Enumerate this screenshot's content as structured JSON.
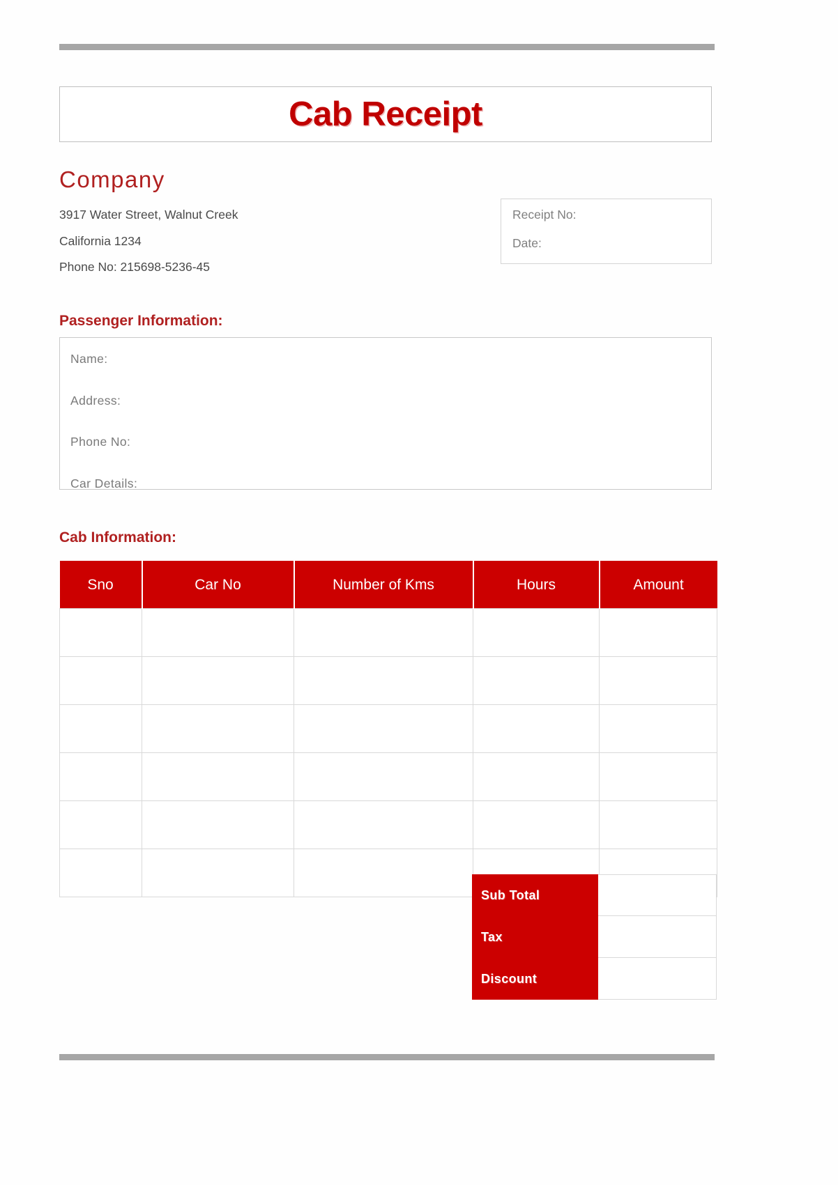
{
  "document": {
    "title": "Cab Receipt"
  },
  "company": {
    "name": "Company",
    "address_line1": "3917 Water Street, Walnut Creek",
    "address_line2": "California 1234",
    "phone": "Phone No: 215698-5236-45"
  },
  "receipt_meta": {
    "receipt_no_label": "Receipt No:",
    "date_label": "Date:"
  },
  "passenger_section": {
    "heading": "Passenger Information:",
    "fields": [
      {
        "label": "Name:"
      },
      {
        "label": "Address:"
      },
      {
        "label": "Phone No:"
      },
      {
        "label": "Car Details:"
      }
    ]
  },
  "cab_section": {
    "heading": "Cab Information:",
    "columns": [
      {
        "label": "Sno"
      },
      {
        "label": "Car No"
      },
      {
        "label": "Number of Kms"
      },
      {
        "label": "Hours"
      },
      {
        "label": "Amount"
      }
    ],
    "empty_row_count": 6,
    "totals": [
      {
        "label": "Sub Total",
        "value": ""
      },
      {
        "label": "Tax",
        "value": ""
      },
      {
        "label": "Discount",
        "value": ""
      }
    ]
  },
  "colors": {
    "brand_red": "#cc0000",
    "heading_red": "#b02020",
    "title_red": "#c00000",
    "rule_gray": "#a6a6a6",
    "border_gray": "#d9d9d9",
    "muted_text": "#7a7a7a"
  }
}
